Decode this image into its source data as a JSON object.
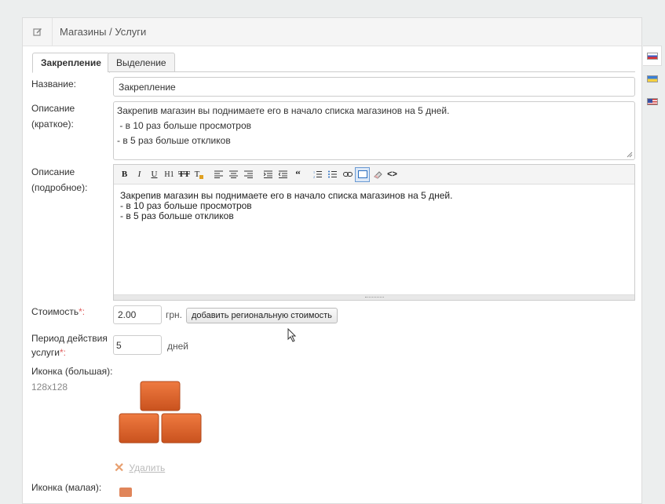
{
  "header": {
    "title": "Магазины / Услуги",
    "icon": "edit-icon"
  },
  "tabs": [
    {
      "label": "Закрепление",
      "active": true
    },
    {
      "label": "Выделение",
      "active": false
    }
  ],
  "form": {
    "name_label": "Название:",
    "name_value": "Закрепление",
    "short_desc_label_1": "Описание",
    "short_desc_label_2": "(краткое):",
    "short_desc_lines": [
      "Закрепив магазин вы поднимаете его в начало списка магазинов на 5 дней.",
      " - в 10 раз больше просмотров",
      "- в 5 раз больше откликов"
    ],
    "full_desc_label_1": "Описание",
    "full_desc_label_2": "(подробное):",
    "full_desc_lines": [
      "Закрепив магазин вы поднимаете его в начало списка магазинов на 5 дней.",
      "- в 10 раз больше просмотров",
      "- в 5 раз больше откликов"
    ],
    "price_label": "Стоимость",
    "price_value": "2.00",
    "price_unit": "грн.",
    "regional_price_button": "добавить региональную стоимость",
    "period_label_1": "Период действия",
    "period_label_2": "услуги",
    "period_value": "5",
    "period_unit": "дней",
    "big_icon_label": "Иконка (большая):",
    "big_icon_size": "128x128",
    "delete_label": "Удалить",
    "small_icon_label": "Иконка (малая):",
    "required_mark": "*:"
  },
  "toolbar_items": [
    "bold",
    "italic",
    "underline",
    "h1",
    "strikethrough",
    "text-color",
    "align-left",
    "align-center",
    "align-right",
    "indent",
    "outdent",
    "blockquote",
    "ordered-list",
    "unordered-list",
    "link",
    "fullscreen",
    "eraser",
    "source"
  ],
  "language_tabs": [
    "ru-flag-icon",
    "ua-flag-icon",
    "en-flag-icon"
  ],
  "colors": {
    "brick": "#e0652e",
    "accent_blue": "#6a9ad3"
  }
}
